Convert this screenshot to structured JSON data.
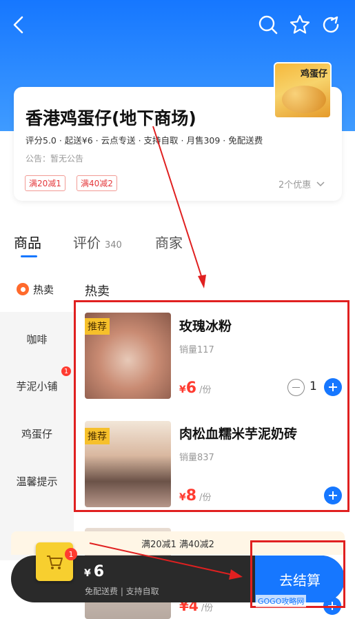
{
  "header": {
    "back_icon": "chevron-left-icon",
    "search_icon": "search-icon",
    "favorite_icon": "star-icon",
    "share_icon": "share-icon"
  },
  "shop": {
    "logo_text": "鸡蛋仔",
    "name": "香港鸡蛋仔(地下商场)",
    "meta": "评分5.0 · 起送¥6 · 云点专送 · 支持自取 · 月售309 · 免配送费",
    "notice": "公告：暂无公告",
    "promos": [
      "满20减1",
      "满40减2"
    ],
    "promo_more": "2个优惠"
  },
  "tabs": [
    {
      "label": "商品",
      "count": ""
    },
    {
      "label": "评价",
      "count": "340"
    },
    {
      "label": "商家",
      "count": ""
    }
  ],
  "categories": {
    "hot": "热卖",
    "items": [
      "咖啡",
      "芋泥小铺",
      "鸡蛋仔",
      "温馨提示"
    ],
    "badge": "1"
  },
  "section_title": "热卖",
  "products": [
    {
      "tag": "推荐",
      "name": "玫瑰冰粉",
      "sales": "销量117",
      "price_symbol": "¥",
      "price": "6",
      "unit": "/份",
      "qty": "1"
    },
    {
      "tag": "推荐",
      "name": "肉松血糯米芋泥奶砖",
      "sales": "销量837",
      "price_symbol": "¥",
      "price": "8",
      "unit": "/份"
    }
  ],
  "peek_product": {
    "price": "¥4",
    "unit": "/份"
  },
  "cart": {
    "promo_strip": "满20减1 满40减2",
    "badge": "1",
    "total_symbol": "¥",
    "total": "6",
    "sub": "免配送费 | 支持自取",
    "checkout": "去结算"
  },
  "watermark": "GOGO攻略网",
  "colors": {
    "brand": "#1677ff",
    "price": "#ff3b30",
    "annotation": "#e02020"
  }
}
